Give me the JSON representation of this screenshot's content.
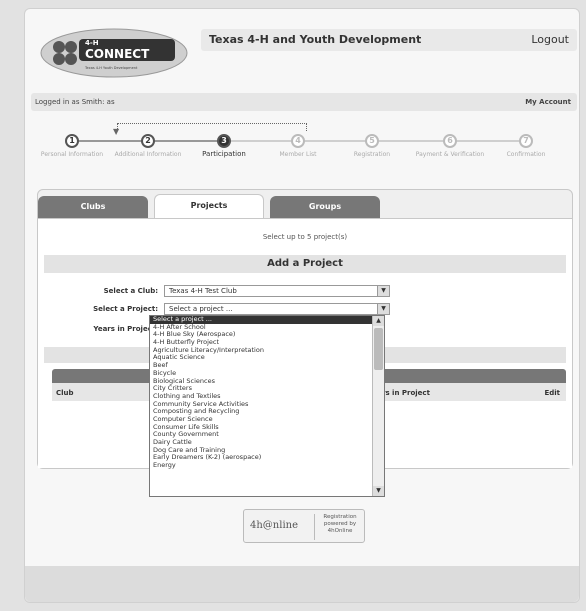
{
  "header": {
    "logo_text": "4-H CONNECT",
    "logo_tagline": "Texas 4-H Youth Development and Engagement System",
    "org_title": "Texas 4-H and Youth Development",
    "logout_label": "Logout"
  },
  "login_bar": {
    "logged_in_text": "Logged in as Smith: as",
    "my_account_label": "My Account"
  },
  "steps": [
    {
      "number": "1",
      "label": "Personal Information",
      "state": "done"
    },
    {
      "number": "2",
      "label": "Additional Information",
      "state": "done"
    },
    {
      "number": "3",
      "label": "Participation",
      "state": "active"
    },
    {
      "number": "4",
      "label": "Member List",
      "state": "future"
    },
    {
      "number": "5",
      "label": "Registration",
      "state": "future"
    },
    {
      "number": "6",
      "label": "Payment & Verification",
      "state": "future"
    },
    {
      "number": "7",
      "label": "Confirmation",
      "state": "future"
    }
  ],
  "tabs": [
    {
      "label": "Clubs",
      "active": false
    },
    {
      "label": "Projects",
      "active": true
    },
    {
      "label": "Groups",
      "active": false
    }
  ],
  "projects": {
    "select_hint": "Select up to 5 project(s)",
    "add_header": "Add a Project",
    "club_label": "Select a Club:",
    "club_value": "Texas 4-H Test Club",
    "project_label": "Select a Project:",
    "project_value": "Select a project ...",
    "years_label": "Years in Project:"
  },
  "table": {
    "col_club": "Club",
    "col_years": "rs in Project",
    "col_edit": "Edit"
  },
  "dropdown_options": [
    "Select a project ...",
    "4-H After School",
    "4-H Blue Sky (Aerospace)",
    "4-H Butterfly Project",
    "Agriculture Literacy/Interpretation",
    "Aquatic Science",
    "Beef",
    "Bicycle",
    "Biological Sciences",
    "City Critters",
    "Clothing and Textiles",
    "Community Service Activities",
    "Composting and Recycling",
    "Computer Science",
    "Consumer Life Skills",
    "County Government",
    "Dairy Cattle",
    "Dog Care and Training",
    "Early Dreamers (K-2) (aerospace)",
    "Energy"
  ],
  "badge": {
    "brand": "4h@nline",
    "text": "Registration powered by 4hOnline"
  },
  "colors": {
    "tab_inactive": "#777777",
    "selected_option": "#333333"
  }
}
